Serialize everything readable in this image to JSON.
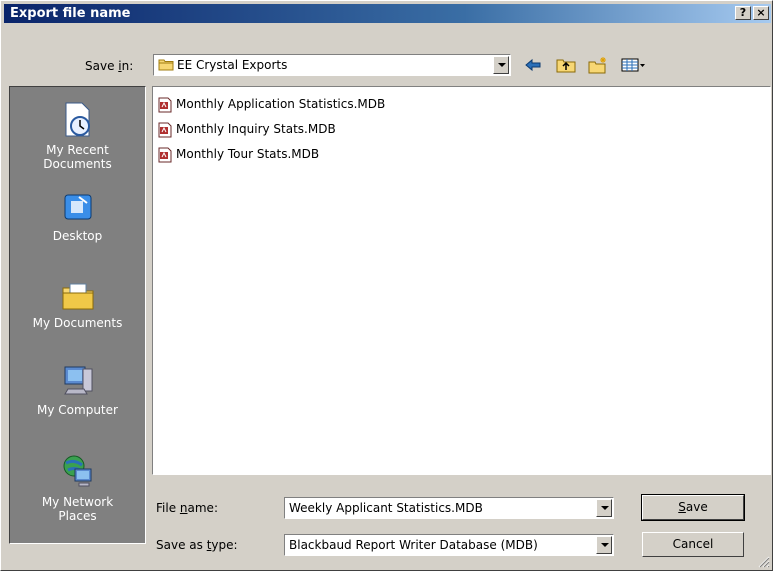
{
  "window": {
    "title": "Export file name"
  },
  "titlebar": {
    "help_label": "?",
    "close_label": "×"
  },
  "save_in": {
    "label_prefix": "Save ",
    "label_hotkey": "i",
    "label_suffix": "n:",
    "value": "EE Crystal Exports",
    "tools": [
      "back-arrow-icon",
      "up-folder-icon",
      "new-folder-icon",
      "view-menu-icon"
    ]
  },
  "places": [
    {
      "label": "My Recent\nDocuments",
      "icon": "recent-documents-icon"
    },
    {
      "label": "Desktop",
      "icon": "desktop-icon"
    },
    {
      "label": "My Documents",
      "icon": "my-documents-icon"
    },
    {
      "label": "My Computer",
      "icon": "my-computer-icon"
    },
    {
      "label": "My Network\nPlaces",
      "icon": "network-places-icon"
    }
  ],
  "files": [
    {
      "name": "Monthly Application Statistics.MDB"
    },
    {
      "name": "Monthly Inquiry Stats.MDB"
    },
    {
      "name": "Monthly Tour Stats.MDB"
    }
  ],
  "file_name": {
    "label_prefix": "File ",
    "label_hotkey": "n",
    "label_suffix": "ame:",
    "value": "Weekly Applicant Statistics.MDB"
  },
  "save_as_type": {
    "label_prefix": "Save as ",
    "label_hotkey": "t",
    "label_suffix": "ype:",
    "value": "Blackbaud Report Writer Database (MDB)"
  },
  "buttons": {
    "save_hotkey": "S",
    "save_rest": "ave",
    "cancel": "Cancel"
  },
  "colors": {
    "title_start": "#0a246a",
    "title_end": "#a6caf0",
    "face": "#d4d0c8",
    "places_bg": "#808080"
  }
}
